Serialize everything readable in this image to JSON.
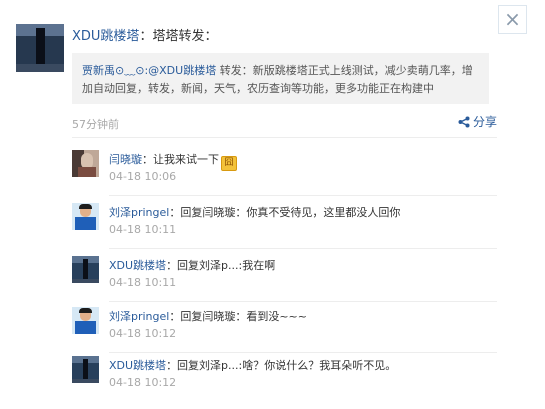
{
  "dialog": {
    "close_label": "×"
  },
  "post": {
    "author": "XDU跳楼塔",
    "separator": "：",
    "content": "塔塔转发：",
    "repost": {
      "author": "贾新禹⊙﹏⊙",
      "mention": ":@XDU跳楼塔",
      "text": " 转发：新版跳楼塔正式上线测试，减少卖萌几率，增加自动回复，转发，新闻，天气，农历查询等功能，更多功能正在构建中"
    },
    "time": "57分钟前",
    "share_label": "分享"
  },
  "comments": [
    {
      "name": "闫晓璇",
      "text": "：让我来试一下",
      "time": "04-18 10:06",
      "emoji": "囧",
      "avatar": "yan"
    },
    {
      "name": "刘泽pringel",
      "text": "：回复闫晓璇：你真不受待见，这里都没人回你",
      "time": "04-18 10:11",
      "avatar": "liu"
    },
    {
      "name": "XDU跳楼塔",
      "text": "：回复刘泽p...:我在啊",
      "time": "04-18 10:11",
      "avatar": "xdu"
    },
    {
      "name": "刘泽pringel",
      "text": "：回复闫晓璇：看到没~~~",
      "time": "04-18 10:12",
      "avatar": "liu"
    },
    {
      "name": "XDU跳楼塔",
      "text": "：回复刘泽p...:啥？你说什么？我耳朵听不见。",
      "time": "04-18 10:12",
      "avatar": "xdu"
    }
  ],
  "icons": {
    "close": "close-icon",
    "share": "share-icon",
    "emoji": "jiong-emoji-icon"
  }
}
